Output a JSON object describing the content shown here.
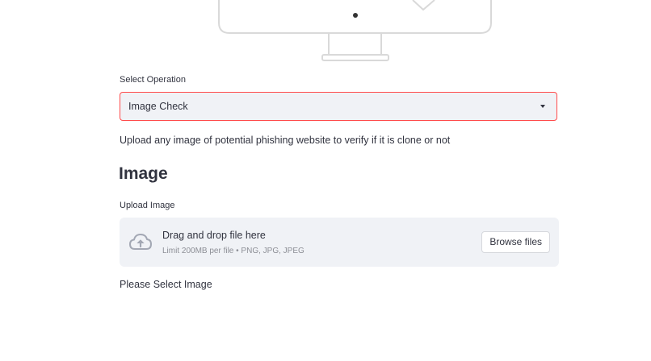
{
  "select_operation": {
    "label": "Select Operation",
    "selected_value": "Image Check",
    "accent_color": "#ff4b4b"
  },
  "description": "Upload any image of potential phishing website to verify if it is clone or not",
  "section_heading": "Image",
  "uploader": {
    "label": "Upload Image",
    "drop_title": "Drag and drop file here",
    "limit_text": "Limit 200MB per file • PNG, JPG, JPEG",
    "browse_button": "Browse files",
    "icon": "cloud-upload-icon"
  },
  "status_message": "Please Select Image",
  "illustration_icon": "monitor-illustration"
}
